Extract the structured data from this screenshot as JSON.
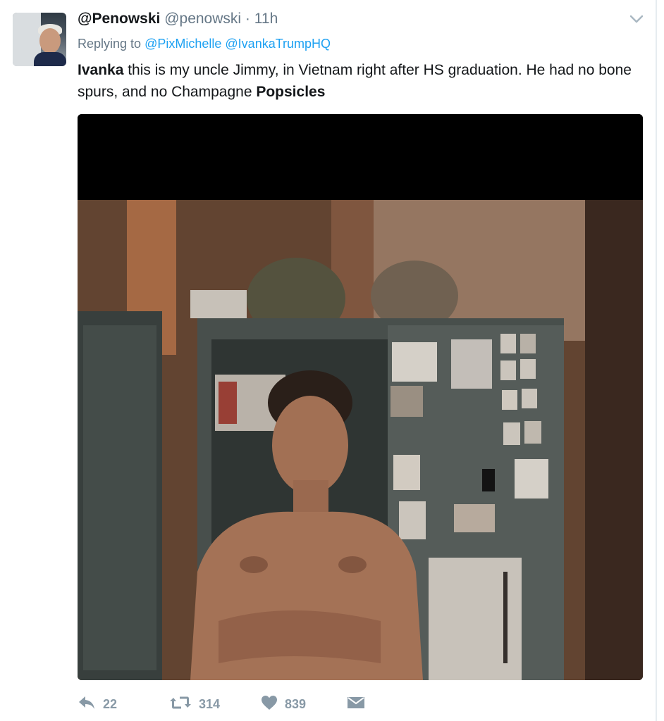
{
  "tweet": {
    "display_name": "@Penowski",
    "handle": "@penowski",
    "separator": "·",
    "time": "11h",
    "reply_prefix": "Replying to",
    "reply_mentions": [
      "@PixMichelle",
      "@IvankaTrumpHQ"
    ],
    "text": {
      "lead_bold": "Ivanka",
      "body": " this is my uncle Jimmy, in Vietnam right after HS graduation. He had no bone spurs, and no Champagne ",
      "tail_bold": "Popsicles"
    },
    "media": {
      "icon": "photo-of-shirtless-soldier-at-locker"
    }
  },
  "actions": {
    "reply": {
      "icon": "reply-icon",
      "count": "22"
    },
    "retweet": {
      "icon": "retweet-icon",
      "count": "314"
    },
    "like": {
      "icon": "heart-icon",
      "count": "839"
    },
    "message": {
      "icon": "direct-message-icon"
    }
  },
  "colors": {
    "text": "#14171a",
    "muted": "#657786",
    "link": "#1da1f2",
    "action_icon": "#8899a6"
  }
}
